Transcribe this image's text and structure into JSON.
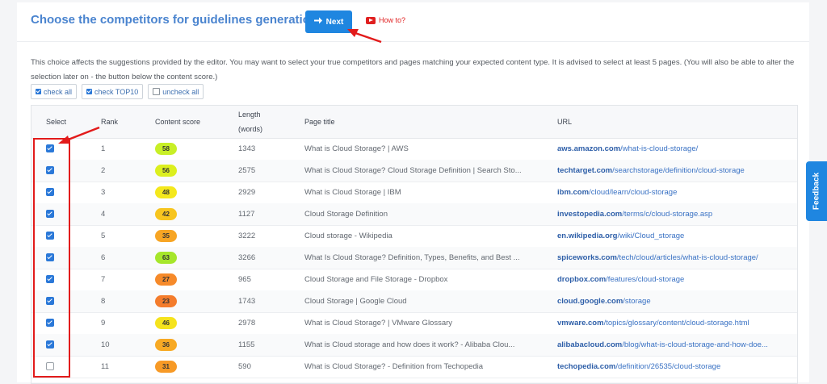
{
  "header": {
    "title": "Choose the competitors for guidelines generation.",
    "next_label": "Next",
    "howto_label": "How to?"
  },
  "description": "This choice affects the suggestions provided by the editor. You may want to select your true competitors and pages matching your expected content type. It is advised to select at least 5 pages. (You will also be able to alter the selection later on - the button below the content score.)",
  "buttons": {
    "check_all": "check all",
    "check_top10": "check TOP10",
    "uncheck_all": "uncheck all"
  },
  "table": {
    "headers": {
      "select": "Select",
      "rank": "Rank",
      "content_score": "Content score",
      "length_line1": "Length",
      "length_line2": "(words)",
      "page_title": "Page title",
      "url": "URL"
    },
    "rows": [
      {
        "checked": true,
        "rank": "1",
        "score": "58",
        "score_color": "#c8ef27",
        "length": "1343",
        "title": "What is Cloud Storage? | AWS",
        "domain": "aws.amazon.com",
        "path": "/what-is-cloud-storage/"
      },
      {
        "checked": true,
        "rank": "2",
        "score": "56",
        "score_color": "#dcef1e",
        "length": "2575",
        "title": "What is Cloud Storage? Cloud Storage Definition | Search Sto...",
        "domain": "techtarget.com",
        "path": "/searchstorage/definition/cloud-storage"
      },
      {
        "checked": true,
        "rank": "3",
        "score": "48",
        "score_color": "#f4e81c",
        "length": "2929",
        "title": "What is Cloud Storage | IBM",
        "domain": "ibm.com",
        "path": "/cloud/learn/cloud-storage"
      },
      {
        "checked": true,
        "rank": "4",
        "score": "42",
        "score_color": "#f7c51f",
        "length": "1127",
        "title": "Cloud Storage Definition",
        "domain": "investopedia.com",
        "path": "/terms/c/cloud-storage.asp"
      },
      {
        "checked": true,
        "rank": "5",
        "score": "35",
        "score_color": "#f7a524",
        "length": "3222",
        "title": "Cloud storage - Wikipedia",
        "domain": "en.wikipedia.org",
        "path": "/wiki/Cloud_storage"
      },
      {
        "checked": true,
        "rank": "6",
        "score": "63",
        "score_color": "#a6e62b",
        "length": "3266",
        "title": "What Is Cloud Storage? Definition, Types, Benefits, and Best ...",
        "domain": "spiceworks.com",
        "path": "/tech/cloud/articles/what-is-cloud-storage/"
      },
      {
        "checked": true,
        "rank": "7",
        "score": "27",
        "score_color": "#f68a2a",
        "length": "965",
        "title": "Cloud Storage and File Storage - Dropbox",
        "domain": "dropbox.com",
        "path": "/features/cloud-storage"
      },
      {
        "checked": true,
        "rank": "8",
        "score": "23",
        "score_color": "#f47c2c",
        "length": "1743",
        "title": "Cloud Storage  |  Google Cloud",
        "domain": "cloud.google.com",
        "path": "/storage"
      },
      {
        "checked": true,
        "rank": "9",
        "score": "46",
        "score_color": "#f5e31d",
        "length": "2978",
        "title": "What is Cloud Storage? | VMware Glossary",
        "domain": "vmware.com",
        "path": "/topics/glossary/content/cloud-storage.html"
      },
      {
        "checked": true,
        "rank": "10",
        "score": "36",
        "score_color": "#f7a924",
        "length": "1155",
        "title": "What is Cloud storage and how does it work? - Alibaba Clou...",
        "domain": "alibabacloud.com",
        "path": "/blog/what-is-cloud-storage-and-how-doe..."
      },
      {
        "checked": false,
        "rank": "11",
        "score": "31",
        "score_color": "#f79a26",
        "length": "590",
        "title": "What is Cloud Storage? - Definition from Techopedia",
        "domain": "techopedia.com",
        "path": "/definition/26535/cloud-storage"
      }
    ]
  },
  "feedback_label": "Feedback",
  "colors": {
    "accent": "#1f86e0",
    "heading": "#4a84cf",
    "annotation_red": "#e21b1b",
    "link": "#3a72c4"
  }
}
